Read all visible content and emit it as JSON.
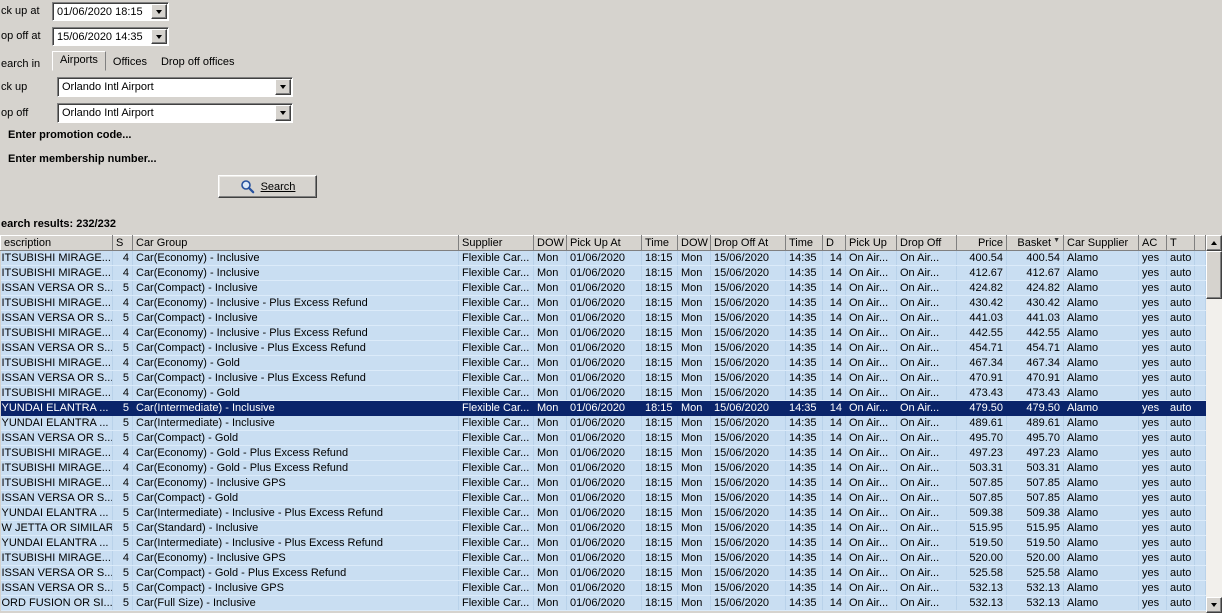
{
  "colors": {
    "window_background": "#d6d3ce",
    "row_background": "#c9def2",
    "selected_row_background": "#0a246a",
    "selected_row_text": "#ffffff"
  },
  "form": {
    "pick_up_at": {
      "label": "ck up at",
      "value": "01/06/2020 18:15"
    },
    "drop_off_at": {
      "label": "op off at",
      "value": "15/06/2020 14:35"
    },
    "search_in": {
      "label": "earch in",
      "tabs": [
        "Airports",
        "Offices",
        "Drop off offices"
      ],
      "active_tab": "Airports"
    },
    "pick_up": {
      "label": "ck up",
      "value": "Orlando Intl Airport"
    },
    "drop_off": {
      "label": "op off",
      "value": "Orlando Intl Airport"
    },
    "promotion_link": "Enter promotion code...",
    "membership_link": "Enter membership number...",
    "search_button_label": "Search"
  },
  "results": {
    "summary": "earch results: 232/232",
    "sort": {
      "column": "Basket",
      "glyph": "▼"
    },
    "selected_row_index": 10,
    "columns": [
      "escription",
      "S",
      "Car Group",
      "Supplier",
      "DOW",
      "Pick Up At",
      "Time",
      "DOW",
      "Drop Off At",
      "Time",
      "D",
      "Pick Up",
      "Drop Off",
      "Price",
      "Basket",
      "Car Supplier",
      "AC",
      "T"
    ],
    "rows": [
      [
        "ITSUBISHI MIRAGE...",
        "4",
        "Car(Economy) - Inclusive",
        "Flexible Car...",
        "Mon",
        "01/06/2020",
        "18:15",
        "Mon",
        "15/06/2020",
        "14:35",
        "14",
        "On Air...",
        "On Air...",
        "400.54",
        "400.54",
        "Alamo",
        "yes",
        "auto"
      ],
      [
        "ITSUBISHI MIRAGE...",
        "4",
        "Car(Economy) - Inclusive",
        "Flexible Car...",
        "Mon",
        "01/06/2020",
        "18:15",
        "Mon",
        "15/06/2020",
        "14:35",
        "14",
        "On Air...",
        "On Air...",
        "412.67",
        "412.67",
        "Alamo",
        "yes",
        "auto"
      ],
      [
        "ISSAN VERSA OR S...",
        "5",
        "Car(Compact) - Inclusive",
        "Flexible Car...",
        "Mon",
        "01/06/2020",
        "18:15",
        "Mon",
        "15/06/2020",
        "14:35",
        "14",
        "On Air...",
        "On Air...",
        "424.82",
        "424.82",
        "Alamo",
        "yes",
        "auto"
      ],
      [
        "ITSUBISHI MIRAGE...",
        "4",
        "Car(Economy) - Inclusive - Plus Excess Refund",
        "Flexible Car...",
        "Mon",
        "01/06/2020",
        "18:15",
        "Mon",
        "15/06/2020",
        "14:35",
        "14",
        "On Air...",
        "On Air...",
        "430.42",
        "430.42",
        "Alamo",
        "yes",
        "auto"
      ],
      [
        "ISSAN VERSA OR S...",
        "5",
        "Car(Compact) - Inclusive",
        "Flexible Car...",
        "Mon",
        "01/06/2020",
        "18:15",
        "Mon",
        "15/06/2020",
        "14:35",
        "14",
        "On Air...",
        "On Air...",
        "441.03",
        "441.03",
        "Alamo",
        "yes",
        "auto"
      ],
      [
        "ITSUBISHI MIRAGE...",
        "4",
        "Car(Economy) - Inclusive - Plus Excess Refund",
        "Flexible Car...",
        "Mon",
        "01/06/2020",
        "18:15",
        "Mon",
        "15/06/2020",
        "14:35",
        "14",
        "On Air...",
        "On Air...",
        "442.55",
        "442.55",
        "Alamo",
        "yes",
        "auto"
      ],
      [
        "ISSAN VERSA OR S...",
        "5",
        "Car(Compact) - Inclusive - Plus Excess Refund",
        "Flexible Car...",
        "Mon",
        "01/06/2020",
        "18:15",
        "Mon",
        "15/06/2020",
        "14:35",
        "14",
        "On Air...",
        "On Air...",
        "454.71",
        "454.71",
        "Alamo",
        "yes",
        "auto"
      ],
      [
        "ITSUBISHI MIRAGE...",
        "4",
        "Car(Economy) - Gold",
        "Flexible Car...",
        "Mon",
        "01/06/2020",
        "18:15",
        "Mon",
        "15/06/2020",
        "14:35",
        "14",
        "On Air...",
        "On Air...",
        "467.34",
        "467.34",
        "Alamo",
        "yes",
        "auto"
      ],
      [
        "ISSAN VERSA OR S...",
        "5",
        "Car(Compact) - Inclusive - Plus Excess Refund",
        "Flexible Car...",
        "Mon",
        "01/06/2020",
        "18:15",
        "Mon",
        "15/06/2020",
        "14:35",
        "14",
        "On Air...",
        "On Air...",
        "470.91",
        "470.91",
        "Alamo",
        "yes",
        "auto"
      ],
      [
        "ITSUBISHI MIRAGE...",
        "4",
        "Car(Economy) - Gold",
        "Flexible Car...",
        "Mon",
        "01/06/2020",
        "18:15",
        "Mon",
        "15/06/2020",
        "14:35",
        "14",
        "On Air...",
        "On Air...",
        "473.43",
        "473.43",
        "Alamo",
        "yes",
        "auto"
      ],
      [
        "YUNDAI ELANTRA ...",
        "5",
        "Car(Intermediate) - Inclusive",
        "Flexible Car...",
        "Mon",
        "01/06/2020",
        "18:15",
        "Mon",
        "15/06/2020",
        "14:35",
        "14",
        "On Air...",
        "On Air...",
        "479.50",
        "479.50",
        "Alamo",
        "yes",
        "auto"
      ],
      [
        "YUNDAI ELANTRA ...",
        "5",
        "Car(Intermediate) - Inclusive",
        "Flexible Car...",
        "Mon",
        "01/06/2020",
        "18:15",
        "Mon",
        "15/06/2020",
        "14:35",
        "14",
        "On Air...",
        "On Air...",
        "489.61",
        "489.61",
        "Alamo",
        "yes",
        "auto"
      ],
      [
        "ISSAN VERSA OR S...",
        "5",
        "Car(Compact) - Gold",
        "Flexible Car...",
        "Mon",
        "01/06/2020",
        "18:15",
        "Mon",
        "15/06/2020",
        "14:35",
        "14",
        "On Air...",
        "On Air...",
        "495.70",
        "495.70",
        "Alamo",
        "yes",
        "auto"
      ],
      [
        "ITSUBISHI MIRAGE...",
        "4",
        "Car(Economy) - Gold - Plus Excess Refund",
        "Flexible Car...",
        "Mon",
        "01/06/2020",
        "18:15",
        "Mon",
        "15/06/2020",
        "14:35",
        "14",
        "On Air...",
        "On Air...",
        "497.23",
        "497.23",
        "Alamo",
        "yes",
        "auto"
      ],
      [
        "ITSUBISHI MIRAGE...",
        "4",
        "Car(Economy) - Gold - Plus Excess Refund",
        "Flexible Car...",
        "Mon",
        "01/06/2020",
        "18:15",
        "Mon",
        "15/06/2020",
        "14:35",
        "14",
        "On Air...",
        "On Air...",
        "503.31",
        "503.31",
        "Alamo",
        "yes",
        "auto"
      ],
      [
        "ITSUBISHI MIRAGE...",
        "4",
        "Car(Economy) - Inclusive GPS",
        "Flexible Car...",
        "Mon",
        "01/06/2020",
        "18:15",
        "Mon",
        "15/06/2020",
        "14:35",
        "14",
        "On Air...",
        "On Air...",
        "507.85",
        "507.85",
        "Alamo",
        "yes",
        "auto"
      ],
      [
        "ISSAN VERSA OR S...",
        "5",
        "Car(Compact) - Gold",
        "Flexible Car...",
        "Mon",
        "01/06/2020",
        "18:15",
        "Mon",
        "15/06/2020",
        "14:35",
        "14",
        "On Air...",
        "On Air...",
        "507.85",
        "507.85",
        "Alamo",
        "yes",
        "auto"
      ],
      [
        "YUNDAI ELANTRA ...",
        "5",
        "Car(Intermediate) - Inclusive - Plus Excess Refund",
        "Flexible Car...",
        "Mon",
        "01/06/2020",
        "18:15",
        "Mon",
        "15/06/2020",
        "14:35",
        "14",
        "On Air...",
        "On Air...",
        "509.38",
        "509.38",
        "Alamo",
        "yes",
        "auto"
      ],
      [
        "W JETTA OR SIMILAR",
        "5",
        "Car(Standard) - Inclusive",
        "Flexible Car...",
        "Mon",
        "01/06/2020",
        "18:15",
        "Mon",
        "15/06/2020",
        "14:35",
        "14",
        "On Air...",
        "On Air...",
        "515.95",
        "515.95",
        "Alamo",
        "yes",
        "auto"
      ],
      [
        "YUNDAI ELANTRA ...",
        "5",
        "Car(Intermediate) - Inclusive - Plus Excess Refund",
        "Flexible Car...",
        "Mon",
        "01/06/2020",
        "18:15",
        "Mon",
        "15/06/2020",
        "14:35",
        "14",
        "On Air...",
        "On Air...",
        "519.50",
        "519.50",
        "Alamo",
        "yes",
        "auto"
      ],
      [
        "ITSUBISHI MIRAGE...",
        "4",
        "Car(Economy) - Inclusive GPS",
        "Flexible Car...",
        "Mon",
        "01/06/2020",
        "18:15",
        "Mon",
        "15/06/2020",
        "14:35",
        "14",
        "On Air...",
        "On Air...",
        "520.00",
        "520.00",
        "Alamo",
        "yes",
        "auto"
      ],
      [
        "ISSAN VERSA OR S...",
        "5",
        "Car(Compact) - Gold - Plus Excess Refund",
        "Flexible Car...",
        "Mon",
        "01/06/2020",
        "18:15",
        "Mon",
        "15/06/2020",
        "14:35",
        "14",
        "On Air...",
        "On Air...",
        "525.58",
        "525.58",
        "Alamo",
        "yes",
        "auto"
      ],
      [
        "ISSAN VERSA OR S...",
        "5",
        "Car(Compact) - Inclusive GPS",
        "Flexible Car...",
        "Mon",
        "01/06/2020",
        "18:15",
        "Mon",
        "15/06/2020",
        "14:35",
        "14",
        "On Air...",
        "On Air...",
        "532.13",
        "532.13",
        "Alamo",
        "yes",
        "auto"
      ],
      [
        "ORD FUSION OR SI...",
        "5",
        "Car(Full Size) - Inclusive",
        "Flexible Car...",
        "Mon",
        "01/06/2020",
        "18:15",
        "Mon",
        "15/06/2020",
        "14:35",
        "14",
        "On Air...",
        "On Air...",
        "532.13",
        "532.13",
        "Alamo",
        "yes",
        "auto"
      ]
    ]
  }
}
